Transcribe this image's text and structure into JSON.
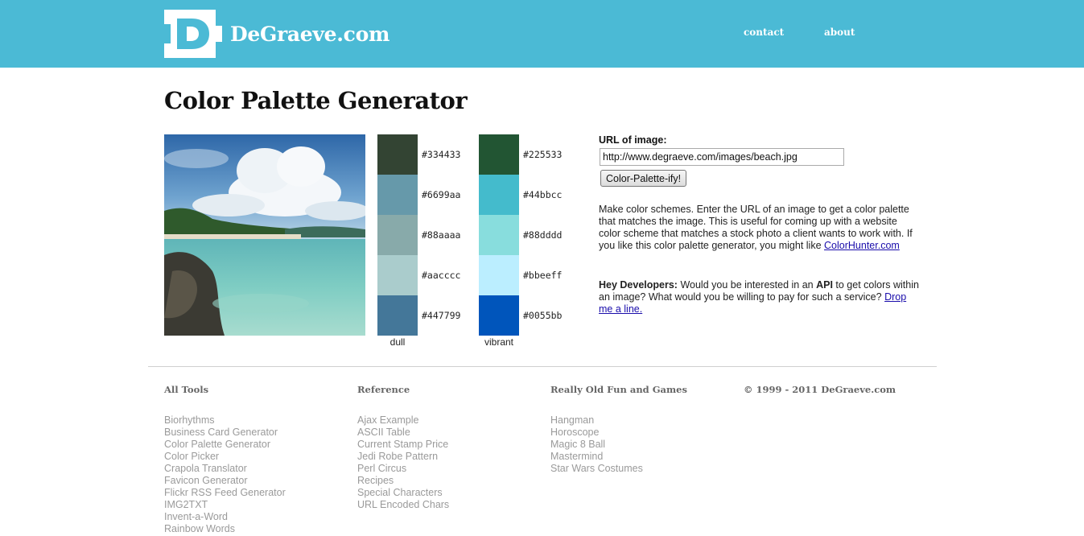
{
  "header": {
    "logo_text": "DeGraeve.com",
    "nav": [
      {
        "label": "contact"
      },
      {
        "label": "about"
      }
    ]
  },
  "page_title": "Color Palette Generator",
  "palettes": {
    "dull": {
      "label": "dull",
      "colors": [
        "#334433",
        "#6699aa",
        "#88aaaa",
        "#aacccc",
        "#447799"
      ]
    },
    "vibrant": {
      "label": "vibrant",
      "colors": [
        "#225533",
        "#44bbcc",
        "#88dddd",
        "#bbeeff",
        "#0055bb"
      ]
    }
  },
  "form": {
    "label": "URL of image:",
    "url_value": "http://www.degraeve.com/images/beach.jpg",
    "button_label": "Color-Palette-ify!"
  },
  "description": {
    "text": "Make color schemes. Enter the URL of an image to get a color palette that matches the image. This is useful for coming up with a website color scheme that matches a stock photo a client wants to work with. If you like this color palette generator, you might like",
    "link": "ColorHunter.com"
  },
  "developers": {
    "lead": "Hey Developers:",
    "text1": " Would you be interested in an ",
    "api": "API",
    "text2": " to get colors within an image? What would you be willing to pay for such a service? ",
    "link": "Drop me a line."
  },
  "footer": {
    "columns": [
      {
        "heading": "All Tools",
        "items": [
          "Biorhythms",
          "Business Card Generator",
          "Color Palette Generator",
          "Color Picker",
          "Crapola Translator",
          "Favicon Generator",
          "Flickr RSS Feed Generator",
          "IMG2TXT",
          "Invent-a-Word",
          "Rainbow Words"
        ]
      },
      {
        "heading": "Reference",
        "items": [
          "Ajax Example",
          "ASCII Table",
          "Current Stamp Price",
          "Jedi Robe Pattern",
          "Perl Circus",
          "Recipes",
          "Special Characters",
          "URL Encoded Chars"
        ]
      },
      {
        "heading": "Really Old Fun and Games",
        "items": [
          "Hangman",
          "Horoscope",
          "Magic 8 Ball",
          "Mastermind",
          "Star Wars Costumes"
        ]
      },
      {
        "heading": "© 1999 - 2011 DeGraeve.com",
        "items": []
      }
    ]
  },
  "colors": {
    "header_bg": "#4bbad5",
    "link": "#1a0dab",
    "footer_link": "#9a9a9a"
  }
}
